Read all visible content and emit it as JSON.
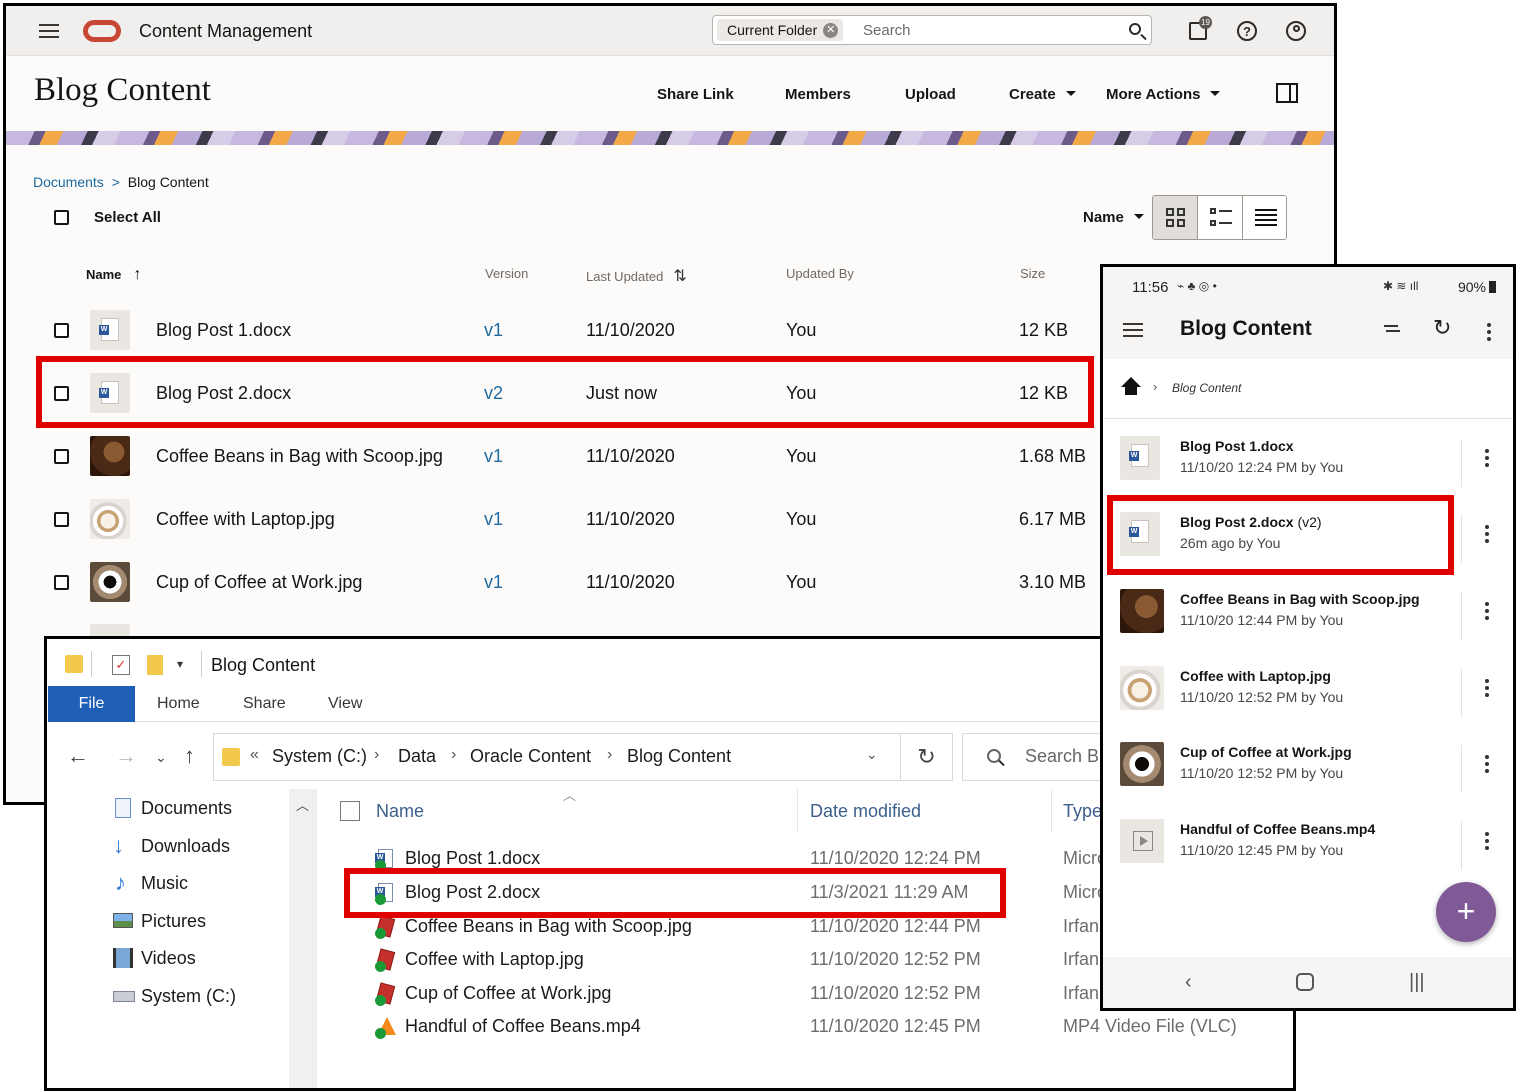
{
  "web": {
    "app_title": "Content Management",
    "search_scope": "Current Folder",
    "search_placeholder": "Search",
    "notification_count": "19",
    "help_label": "?",
    "page_title": "Blog Content",
    "actions": [
      "Share Link",
      "Members",
      "Upload",
      "Create",
      "More Actions"
    ],
    "breadcrumb": {
      "root": "Documents",
      "sep": ">",
      "current": "Blog Content"
    },
    "select_all": "Select All",
    "sort_by": "Name",
    "columns": {
      "name": "Name",
      "version": "Version",
      "last_updated": "Last Updated",
      "updated_by": "Updated By",
      "size": "Size"
    },
    "rows": [
      {
        "name": "Blog Post 1.docx",
        "version": "v1",
        "updated": "11/10/2020",
        "by": "You",
        "size": "12 KB"
      },
      {
        "name": "Blog Post 2.docx",
        "version": "v2",
        "updated": "Just now",
        "by": "You",
        "size": "12 KB"
      },
      {
        "name": "Coffee Beans in Bag with Scoop.jpg",
        "version": "v1",
        "updated": "11/10/2020",
        "by": "You",
        "size": "1.68 MB"
      },
      {
        "name": "Coffee with Laptop.jpg",
        "version": "v1",
        "updated": "11/10/2020",
        "by": "You",
        "size": "6.17 MB"
      },
      {
        "name": "Cup of Coffee at Work.jpg",
        "version": "v1",
        "updated": "11/10/2020",
        "by": "You",
        "size": "3.10 MB"
      }
    ]
  },
  "explorer": {
    "title": "Blog Content",
    "tabs": [
      "File",
      "Home",
      "Share",
      "View"
    ],
    "path": [
      "System (C:)",
      "Data",
      "Oracle Content",
      "Blog Content"
    ],
    "path_prefix": "«",
    "search_placeholder": "Search Bl",
    "nav": [
      "Documents",
      "Downloads",
      "Music",
      "Pictures",
      "Videos",
      "System (C:)"
    ],
    "columns": {
      "name": "Name",
      "date": "Date modified",
      "type": "Type"
    },
    "files": [
      {
        "name": "Blog Post 1.docx",
        "date": "11/10/2020 12:24 PM",
        "type": "Micro"
      },
      {
        "name": "Blog Post 2.docx",
        "date": "11/3/2021 11:29 AM",
        "type": "Micro"
      },
      {
        "name": "Coffee Beans in Bag with Scoop.jpg",
        "date": "11/10/2020 12:44 PM",
        "type": "Irfan"
      },
      {
        "name": "Coffee with Laptop.jpg",
        "date": "11/10/2020 12:52 PM",
        "type": "Irfan"
      },
      {
        "name": "Cup of Coffee at Work.jpg",
        "date": "11/10/2020 12:52 PM",
        "type": "Irfan"
      },
      {
        "name": "Handful of Coffee Beans.mp4",
        "date": "11/10/2020 12:45 PM",
        "type": "MP4 Video File (VLC)"
      }
    ]
  },
  "phone": {
    "time": "11:56",
    "battery": "90%",
    "title": "Blog Content",
    "breadcrumb": "Blog Content",
    "items": [
      {
        "name": "Blog Post 1.docx",
        "version": "",
        "meta": "11/10/20 12:24 PM by You"
      },
      {
        "name": "Blog Post 2.docx",
        "version": "(v2)",
        "meta": "26m ago by You"
      },
      {
        "name": "Coffee Beans in Bag with Scoop.jpg",
        "version": "",
        "meta": "11/10/20 12:44 PM by You"
      },
      {
        "name": "Coffee with Laptop.jpg",
        "version": "",
        "meta": "11/10/20 12:52 PM by You"
      },
      {
        "name": "Cup of Coffee at Work.jpg",
        "version": "",
        "meta": "11/10/20 12:52 PM by You"
      },
      {
        "name": "Handful of Coffee Beans.mp4",
        "version": "",
        "meta": "11/10/20 12:45 PM by You"
      }
    ],
    "fab_label": "+"
  },
  "colors": {
    "highlight": "#e00000",
    "link": "#1e6aa0",
    "oracle_red": "#c74634",
    "fab": "#7f5a96",
    "explorer_file_tab": "#1f5fb8"
  }
}
